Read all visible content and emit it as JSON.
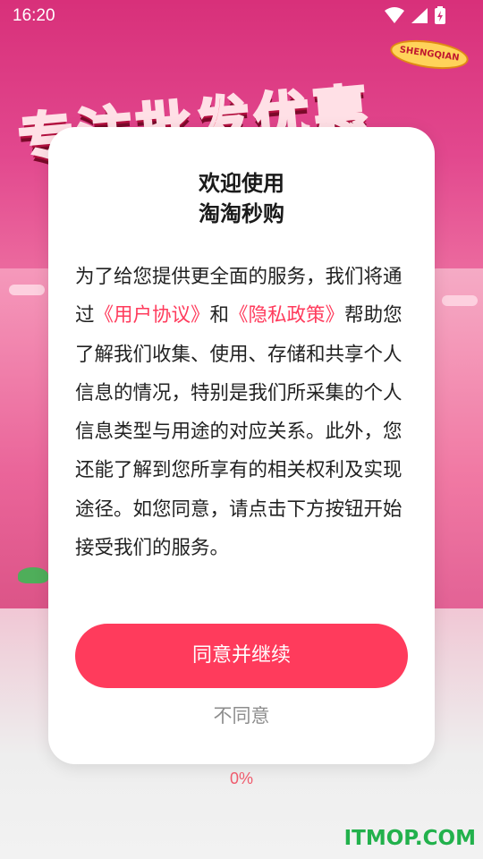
{
  "status_bar": {
    "time": "16:20",
    "icons": [
      "wifi-icon",
      "signal-icon",
      "battery-charging-icon"
    ]
  },
  "background": {
    "banner_text": "专注批发优惠",
    "badge_text": "SHENGQIAN"
  },
  "dialog": {
    "title_line1": "欢迎使用",
    "title_line2": "淘淘秒购",
    "body": {
      "p1": "为了给您提供更全面的服务，我们将通过",
      "link_user_agreement": "《用户协议》",
      "p2": "和",
      "link_privacy_policy": "《隐私政策》",
      "p3": "帮助您了解我们收集、使用、存储和共享个人信息的情况，特别是我们所采集的个人信息类型与用途的对应关系。此外，您还能了解到您所享有的相关权利及实现途径。如您同意，请点击下方按钮开始接受我们的服务。"
    },
    "agree_button": "同意并继续",
    "disagree_button": "不同意"
  },
  "progress": {
    "text": "0%",
    "value": 0
  },
  "watermark": "ITMOP.COM",
  "colors": {
    "accent": "#ff3b5c",
    "progress_text": "#ef5a6c",
    "watermark": "#22b14c"
  }
}
